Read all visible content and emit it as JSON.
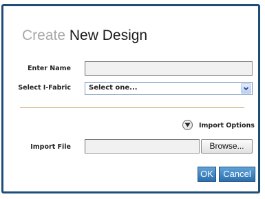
{
  "dialog": {
    "title_prefix": "Create",
    "title_main": "New Design"
  },
  "form": {
    "name_label": "Enter Name",
    "name_value": "",
    "fabric_label": "Select I-Fabric",
    "fabric_selected": "Select one...",
    "import_options_label": "Import Options",
    "import_file_label": "Import File",
    "import_file_value": ""
  },
  "buttons": {
    "browse": "Browse...",
    "ok": "OK",
    "cancel": "Cancel"
  },
  "icons": {
    "dropdown_arrow": "chevron-down-icon",
    "expand_options": "expand-circle-icon"
  },
  "colors": {
    "dialog_border": "#1f4d7a",
    "divider": "#c9a86b",
    "primary_button": "#3a7fbf",
    "title_prefix": "#a8a8a8"
  }
}
